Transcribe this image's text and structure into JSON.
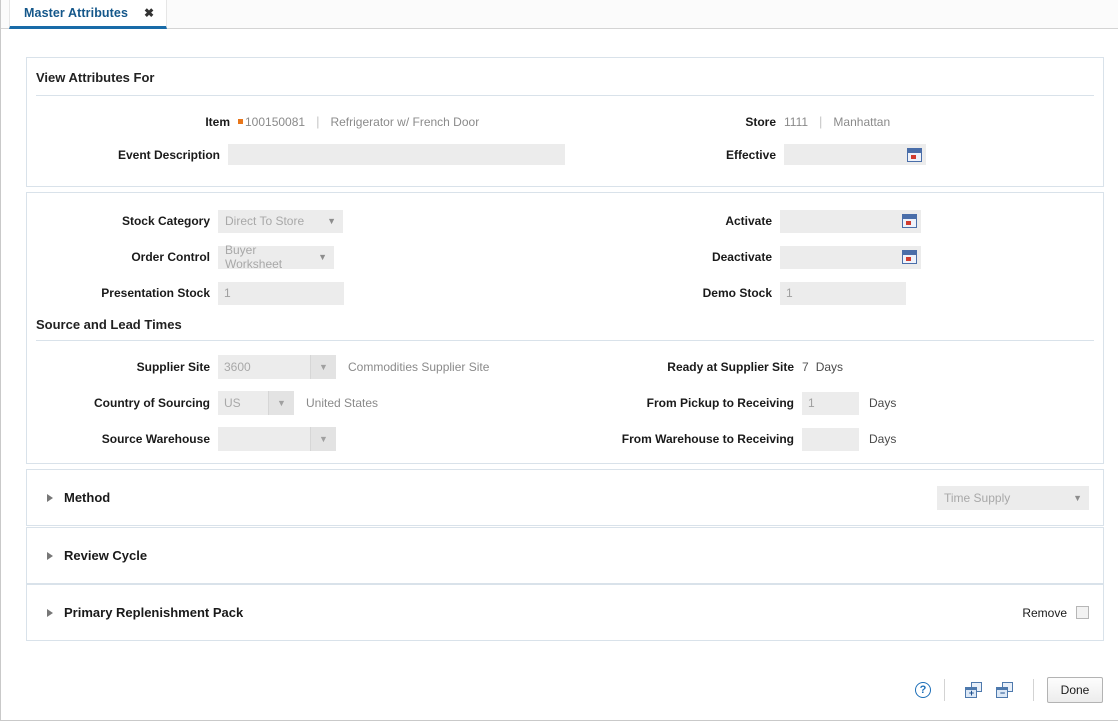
{
  "tab": {
    "label": "Master Attributes",
    "close": "✖"
  },
  "view_attributes": {
    "title": "View Attributes For",
    "item": {
      "label": "Item",
      "value": "100150081",
      "description": "Refrigerator w/ French Door",
      "separator": "|"
    },
    "store": {
      "label": "Store",
      "value": "1111",
      "description": "Manhattan",
      "separator": "|"
    },
    "event_description": {
      "label": "Event Description",
      "value": ""
    },
    "effective": {
      "label": "Effective",
      "value": "",
      "icon": "calendar-icon"
    }
  },
  "attributes": {
    "stock_category": {
      "label": "Stock Category",
      "value": "Direct To Store"
    },
    "order_control": {
      "label": "Order Control",
      "value": "Buyer Worksheet"
    },
    "presentation_stock": {
      "label": "Presentation Stock",
      "value": "1"
    },
    "activate": {
      "label": "Activate",
      "value": "",
      "icon": "calendar-icon"
    },
    "deactivate": {
      "label": "Deactivate",
      "value": "",
      "icon": "calendar-icon"
    },
    "demo_stock": {
      "label": "Demo Stock",
      "value": "1"
    },
    "source_lead_times": {
      "title": "Source and Lead Times",
      "supplier_site": {
        "label": "Supplier Site",
        "value": "3600",
        "description": "Commodities Supplier Site"
      },
      "country_of_sourcing": {
        "label": "Country of Sourcing",
        "value": "US",
        "description": "United States"
      },
      "source_warehouse": {
        "label": "Source Warehouse",
        "value": ""
      },
      "ready_at_supplier_site": {
        "label": "Ready at Supplier Site",
        "value": "7",
        "unit": "Days"
      },
      "from_pickup_to_receiving": {
        "label": "From Pickup to Receiving",
        "value": "1",
        "unit": "Days"
      },
      "from_warehouse_to_receiving": {
        "label": "From Warehouse to Receiving",
        "value": "",
        "unit": "Days"
      }
    }
  },
  "sections": {
    "method": {
      "title": "Method",
      "select_value": "Time Supply"
    },
    "review_cycle": {
      "title": "Review Cycle"
    },
    "primary_replenishment_pack": {
      "title": "Primary Replenishment Pack",
      "remove_label": "Remove",
      "remove_checked": false
    }
  },
  "footer": {
    "help": "?",
    "add_icon_sign": "+",
    "remove_icon_sign": "−",
    "done_label": "Done"
  },
  "colors": {
    "accent": "#186ba8",
    "tab_text": "#14578a",
    "required_marker": "#e8761a",
    "panel_border": "#d9e2ea",
    "field_bg": "#ececec"
  }
}
